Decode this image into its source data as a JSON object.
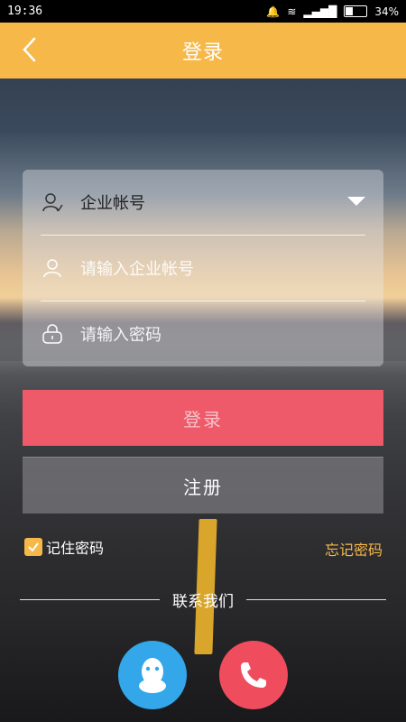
{
  "status_bar": {
    "time": "19:36",
    "battery": "34%"
  },
  "header": {
    "title": "登录"
  },
  "form": {
    "account_type": "企业帐号",
    "account_placeholder": "请输入企业帐号",
    "password_placeholder": "请输入密码"
  },
  "buttons": {
    "login": "登录",
    "register": "注册"
  },
  "options": {
    "remember": "记住密码",
    "forgot": "忘记密码"
  },
  "contact": {
    "label": "联系我们"
  },
  "colors": {
    "accent": "#f7b84a",
    "login": "#ef5a6a",
    "qq": "#33a7e9",
    "phone": "#ef4d5e"
  }
}
